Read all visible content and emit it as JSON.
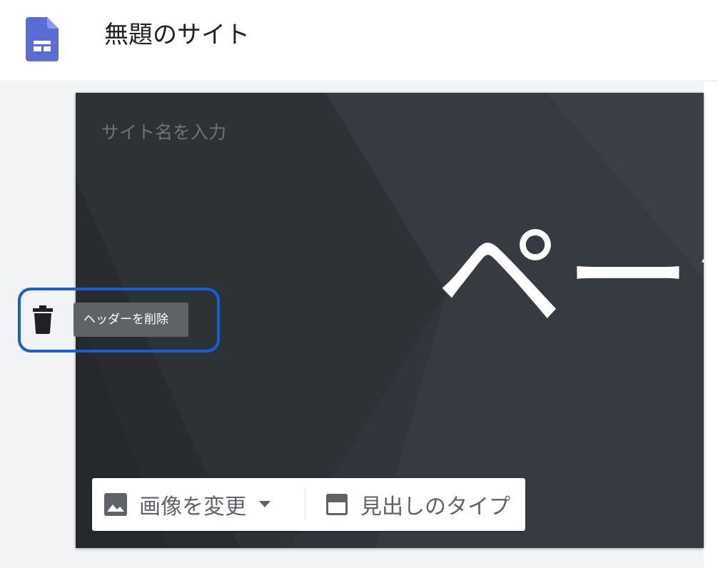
{
  "app": {
    "title": "無題のサイト",
    "logo_icon": "google-sites-icon",
    "brand_color": "#5b6cd4"
  },
  "header": {
    "site_name_placeholder": "サイト名を入力",
    "page_title": "ページ",
    "background_color": "#30363c"
  },
  "side_controls": {
    "delete_icon": "trash-icon",
    "tooltip": "ヘッダーを削除",
    "highlight_color": "#1a5fd1"
  },
  "toolbar": {
    "change_image_label": "画像を変更",
    "change_image_icon": "image-icon",
    "dropdown_icon": "caret-down-icon",
    "heading_type_label": "見出しのタイプ",
    "heading_type_icon": "header-layout-icon"
  }
}
